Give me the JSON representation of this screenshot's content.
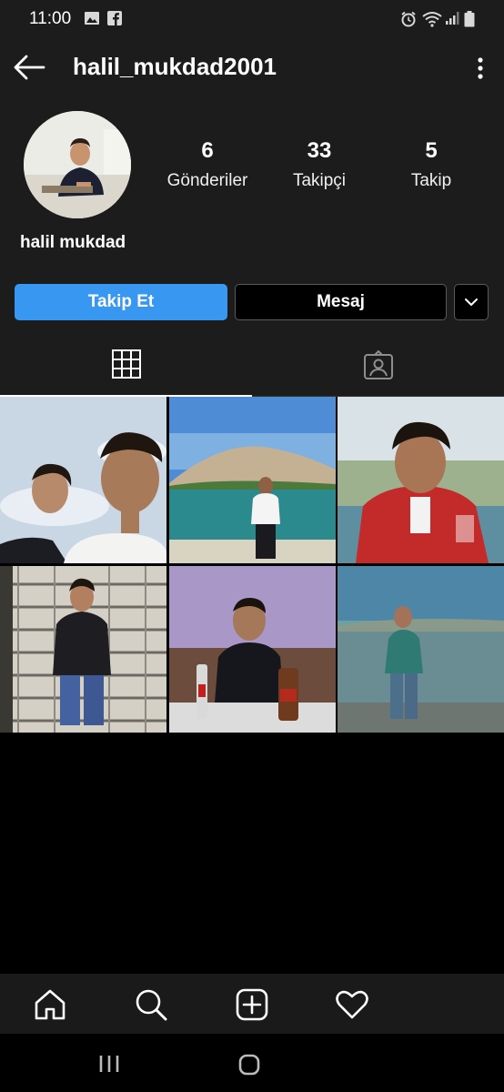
{
  "status_bar": {
    "time": "11:00",
    "icons": [
      "gallery-icon",
      "facebook-icon",
      "alarm-icon",
      "wifi-icon",
      "signal-icon",
      "battery-icon"
    ]
  },
  "header": {
    "username": "halil_mukdad2001",
    "back_icon": "arrow-left-icon",
    "more_icon": "more-vertical-icon"
  },
  "profile": {
    "display_name": "halil mukdad",
    "stats": [
      {
        "value": "6",
        "label": "Gönderiler"
      },
      {
        "value": "33",
        "label": "Takipçi"
      },
      {
        "value": "5",
        "label": "Takip"
      }
    ]
  },
  "actions": {
    "follow_label": "Takip Et",
    "message_label": "Mesaj",
    "dropdown_icon": "chevron-down-icon"
  },
  "tabs": [
    {
      "icon": "grid-icon",
      "active": true
    },
    {
      "icon": "tagged-person-icon",
      "active": false
    }
  ],
  "posts_count": 6,
  "bottom_nav": [
    "home-icon",
    "search-icon",
    "add-post-icon",
    "heart-icon"
  ],
  "system_nav": [
    "recent-apps-icon",
    "home-circle-icon"
  ],
  "colors": {
    "background": "#000000",
    "surface": "#1c1c1c",
    "follow_button": "#3897f0",
    "text": "#ffffff"
  }
}
